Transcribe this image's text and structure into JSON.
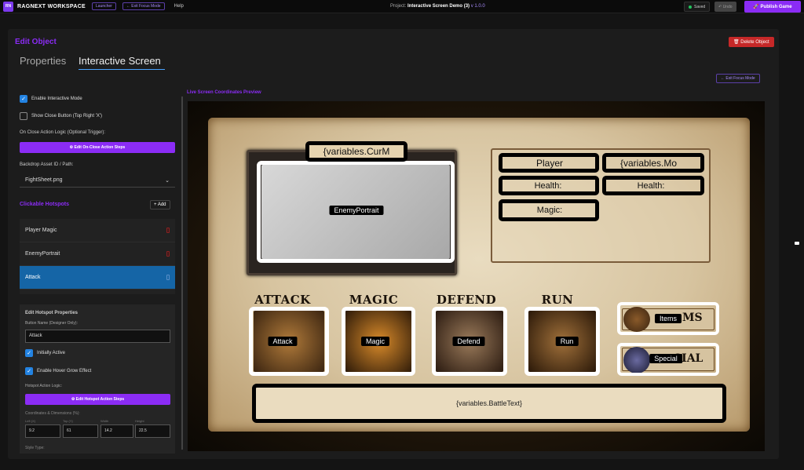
{
  "topbar": {
    "logo": "RN",
    "brand": "RAGNEXT WORKSPACE",
    "launcher": "Launcher",
    "exit_focus": "← Exit Focus Mode",
    "help": "Help",
    "project_label": "Project:",
    "project_name": "Interactive Screen Demo (3)",
    "version": "v 1.0.0",
    "saved": "Saved",
    "undo": "↶ Undo",
    "publish": "🚀 Publish Game"
  },
  "modal": {
    "title": "Edit Object",
    "delete": "🗑 Delete Object",
    "tabs": [
      "Properties",
      "Interactive Screen"
    ]
  },
  "left": {
    "enable_interactive": "Enable Interactive Mode",
    "show_close": "Show Close Button (Top Right 'X')",
    "on_close_label": "On Close Action Logic (Optional Trigger):",
    "on_close_btn": "⚙ Edit On-Close Action Steps",
    "backdrop_label": "Backdrop Asset ID / Path:",
    "backdrop_value": "FightSheet.png",
    "hotspots_title": "Clickable Hotspots",
    "add": "+ Add",
    "hotspots": [
      "Player Magic",
      "EnemyPortrait",
      "Attack"
    ],
    "props_title": "Edit Hotspot Properties",
    "button_name_label": "Button Name (Designer Only):",
    "button_name": "Attack",
    "initially_active": "Initially Active",
    "hover_grow": "Enable Hover Grow Effect",
    "action_logic_label": "Hotspot Action Logic:",
    "action_btn": "⚙ Edit Hotspot Action Steps",
    "coords_label": "Coordinates & Dimensions (%):",
    "coord_labels": [
      "Left (X)",
      "Top (Y)",
      "Width",
      "Height"
    ],
    "coords": [
      "9.2",
      "61",
      "14.2",
      "22.5"
    ],
    "style_type": "Style Type:"
  },
  "preview": {
    "exit_focus": "← Exit Focus Mode",
    "label": "Live Screen Coordinates Preview",
    "cur_monster": "{variables.CurM",
    "enemy_portrait": "EnemyPortrait",
    "player": "Player",
    "monster_var": "{variables.Mo",
    "health1": "Health:",
    "health2": "Health:",
    "magic": "Magic:",
    "headings": [
      "ATTACK",
      "MAGIC",
      "DEFEND",
      "RUN"
    ],
    "actions": [
      "Attack",
      "Magic",
      "Defend",
      "Run"
    ],
    "items": "Items",
    "items_bg": "MS",
    "special": "Special",
    "special_bg": "CIAL",
    "battle_text": "{variables.BattleText}"
  }
}
